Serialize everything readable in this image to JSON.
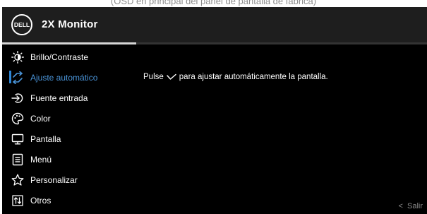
{
  "caption": "(OSD en principal del panel de pantalla de fábrica)",
  "header": {
    "logo_text": "DELL",
    "title": "2X Monitor"
  },
  "menu": {
    "active_index": 1,
    "items": [
      {
        "label": "Brillo/Contraste",
        "icon": "brightness-icon"
      },
      {
        "label": "Ajuste automático",
        "icon": "auto-adjust-icon"
      },
      {
        "label": "Fuente entrada",
        "icon": "input-source-icon"
      },
      {
        "label": "Color",
        "icon": "color-palette-icon"
      },
      {
        "label": "Pantalla",
        "icon": "display-icon"
      },
      {
        "label": "Menú",
        "icon": "menu-icon"
      },
      {
        "label": "Personalizar",
        "icon": "star-icon"
      },
      {
        "label": "Otros",
        "icon": "others-icon"
      }
    ]
  },
  "content": {
    "text_before": "Pulse",
    "text_after": "para ajustar automáticamente la pantalla.",
    "key_icon": "checkmark-icon"
  },
  "footer": {
    "exit_label": "Salir",
    "exit_icon": "chevron-left-icon"
  },
  "colors": {
    "background": "#000000",
    "header": "#1e1e1e",
    "accent": "#2f86d6",
    "active_text": "#4a94d8"
  }
}
